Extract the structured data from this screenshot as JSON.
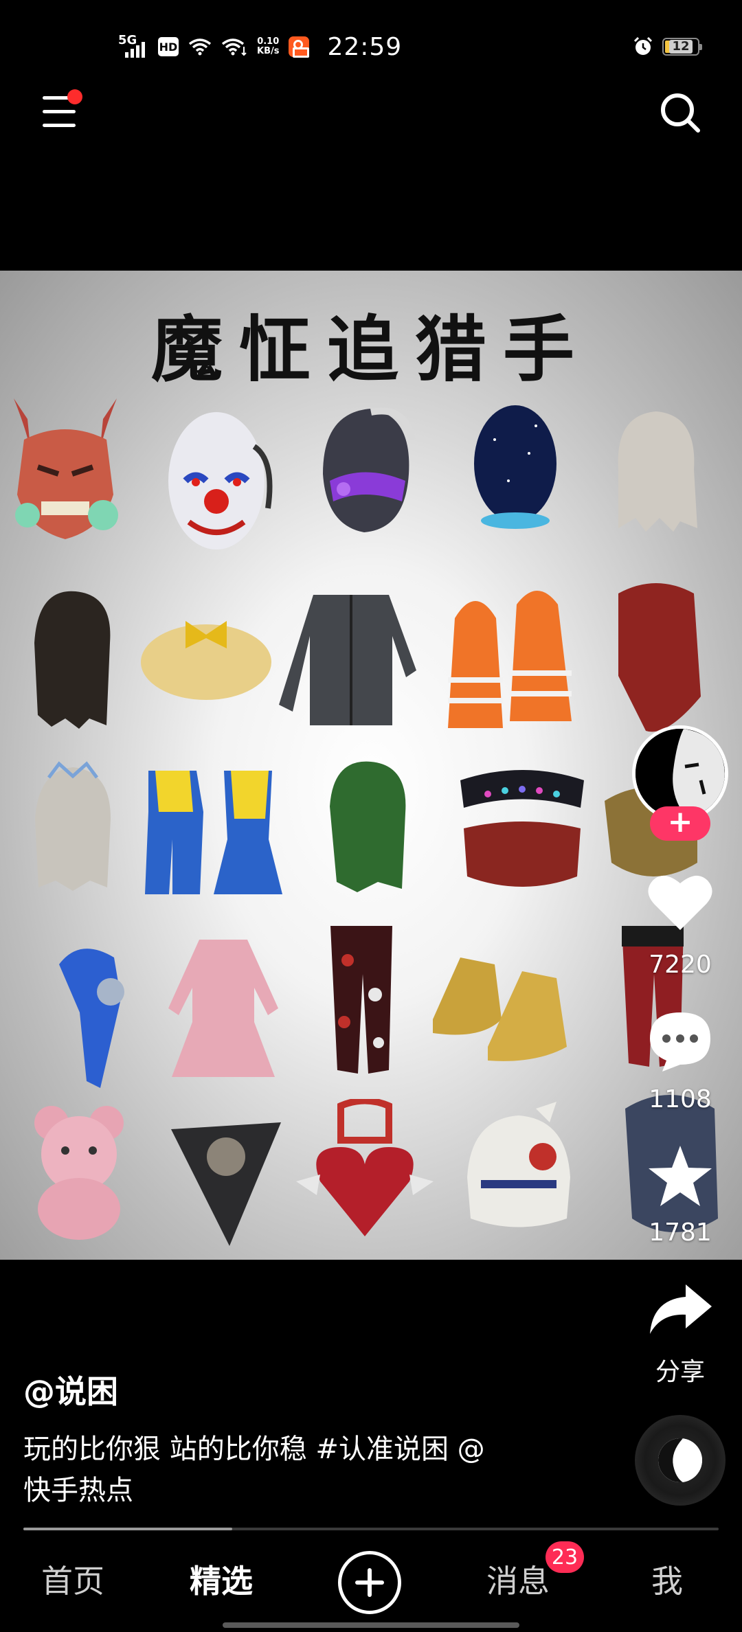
{
  "status_bar": {
    "network": "5G",
    "hd": "HD",
    "speed_value": "0.10",
    "speed_unit": "KB/s",
    "time": "22:59",
    "battery": "12"
  },
  "icons": {
    "menu": "menu-icon",
    "search": "search-icon",
    "like": "heart-icon",
    "comment": "comment-icon",
    "favorite": "star-icon",
    "share": "share-icon"
  },
  "media": {
    "title": "魔怔追猎手"
  },
  "actions": {
    "likes": "7220",
    "comments": "1108",
    "favorites": "1781",
    "share_label": "分享",
    "follow_symbol": "+"
  },
  "post": {
    "author": "@说困",
    "caption_line1": "玩的比你狠 站的比你稳 #认准说困 @",
    "caption_line2": "快手热点"
  },
  "playback": {
    "progress": 0.3
  },
  "nav": {
    "home": "首页",
    "featured": "精选",
    "messages": "消息",
    "messages_badge": "23",
    "me": "我"
  },
  "colors": {
    "accent": "#fe2c55",
    "follow": "#fe3666",
    "background": "#000000",
    "app_orange": "#ff5a1f"
  }
}
